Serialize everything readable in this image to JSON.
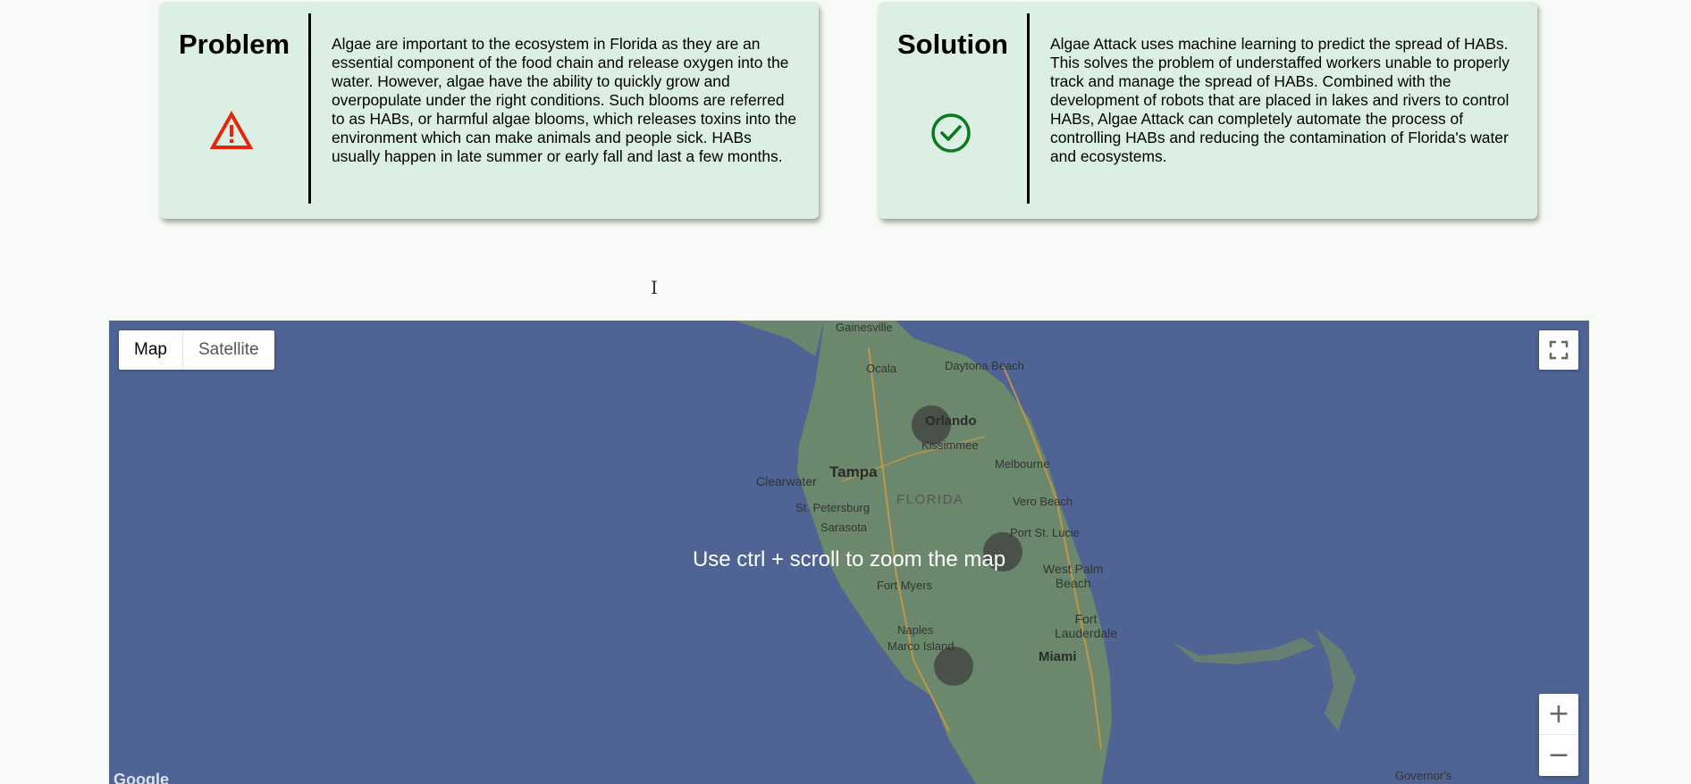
{
  "problem": {
    "title": "Problem",
    "text": "Algae are important to the ecosystem in Florida as they are an essential component of the food chain and release oxygen into the water. However, algae have the ability to quickly grow and overpopulate under the right conditions. Such blooms are referred to as HABs, or harmful algae blooms, which releases toxins into the environment which can make animals and people sick. HABs usually happen in late summer or early fall and last a few months.",
    "icon": "warning-icon",
    "icon_color": "#e8250c"
  },
  "solution": {
    "title": "Solution",
    "text": "Algae Attack uses machine learning to predict the spread of HABs. This solves the problem of understaffed workers unable to properly track and manage the spread of HABs. Combined with the development of robots that are placed in lakes and rivers to control HABs, Algae Attack can completely automate the process of controlling HABs and reducing the contamination of Florida's water and ecosystems.",
    "icon": "check-circle-icon",
    "icon_color": "#0a7a1e"
  },
  "map": {
    "type_buttons": {
      "map": "Map",
      "satellite": "Satellite"
    },
    "overlay_message": "Use ctrl + scroll to zoom the map",
    "zoom_in": "+",
    "zoom_out": "−",
    "logo": "Google",
    "water_color": "#4f6494",
    "land_color": "#6d8a6a",
    "labels": {
      "gainesville": "Gainesville",
      "daytona": "Daytona Beach",
      "ocala": "Ocala",
      "orlando": "Orlando",
      "kissimmee": "Kissimmee",
      "clearwater": "Clearwater",
      "tampa": "Tampa",
      "melbourne": "Melbourne",
      "florida": "FLORIDA",
      "vero": "Vero Beach",
      "stpete": "St. Petersburg",
      "sarasota": "Sarasota",
      "portstlucie": "Port St. Lucie",
      "westpalm": "West Palm\nBeach",
      "fortmyers": "Fort Myers",
      "naples": "Naples",
      "ftlauderdale": "Fort\nLauderdale",
      "marco": "Marco Island",
      "miami": "Miami",
      "governors": "Governor's"
    }
  }
}
